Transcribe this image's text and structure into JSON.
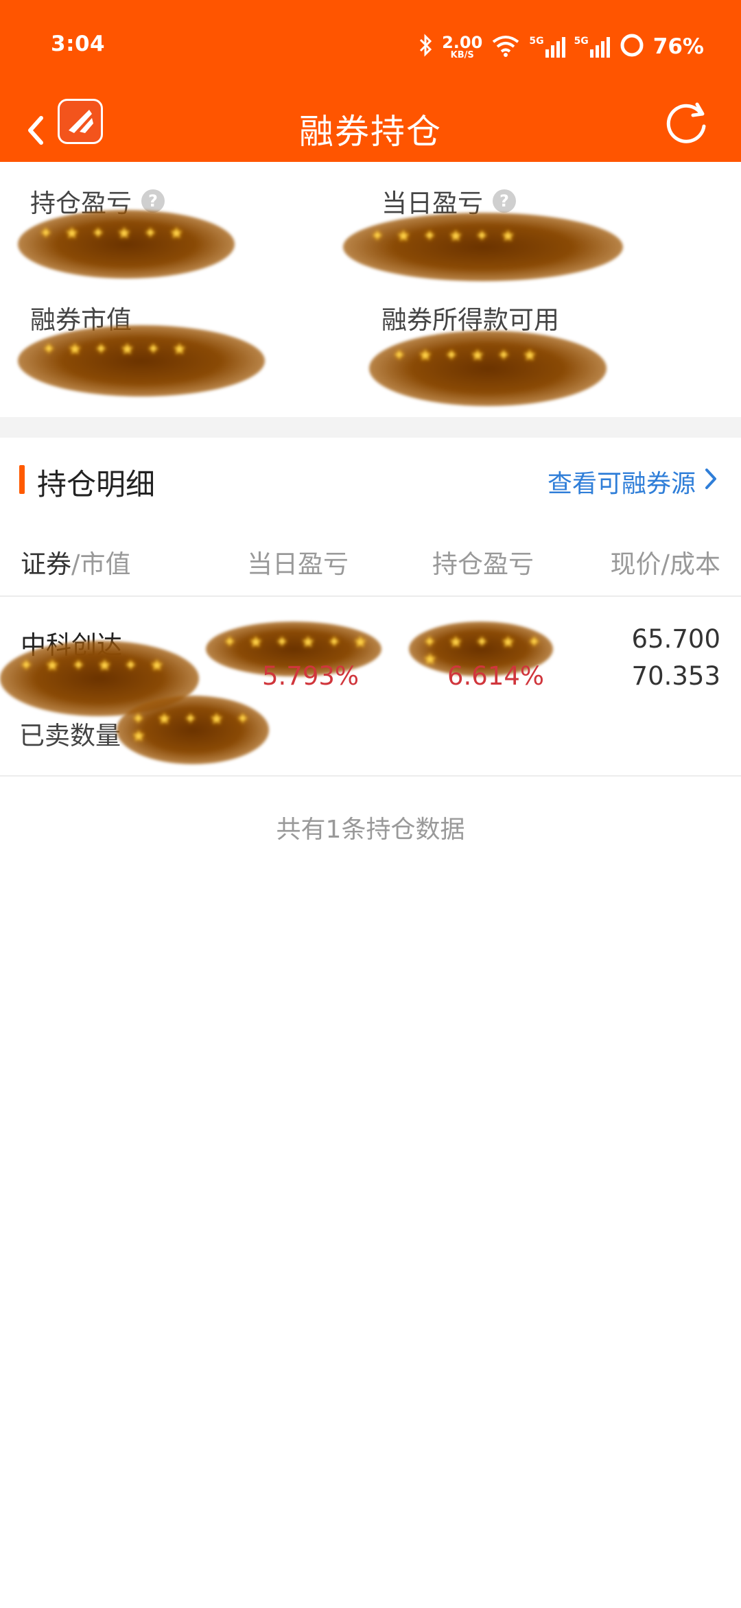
{
  "status_bar": {
    "time": "3:04",
    "net_speed": "2.00",
    "net_unit": "KB/S",
    "signal1": "5G",
    "signal2": "5G",
    "battery": "76%"
  },
  "nav": {
    "title": "融券持仓"
  },
  "summary": {
    "position_pl_label": "持仓盈亏",
    "daily_pl_label": "当日盈亏",
    "market_value_label": "融券市值",
    "proceeds_label": "融券所得款可用",
    "help_glyph": "?"
  },
  "detail": {
    "title": "持仓明细",
    "link": "查看可融券源"
  },
  "table": {
    "col1_main": "证券",
    "col1_sub": "/市值",
    "col2": "当日盈亏",
    "col3": "持仓盈亏",
    "col4_main": "现价",
    "col4_sub": "/成本",
    "rows": [
      {
        "name": "中科创达",
        "sold_label": "已卖数量",
        "daily_pct": "5.793%",
        "position_pct": "6.614%",
        "price": "65.700",
        "cost": "70.353"
      }
    ]
  },
  "footer": "共有1条持仓数据",
  "colors": {
    "brand": "#ff5500",
    "link": "#2f7ed8",
    "loss_red": "#d0363c"
  }
}
